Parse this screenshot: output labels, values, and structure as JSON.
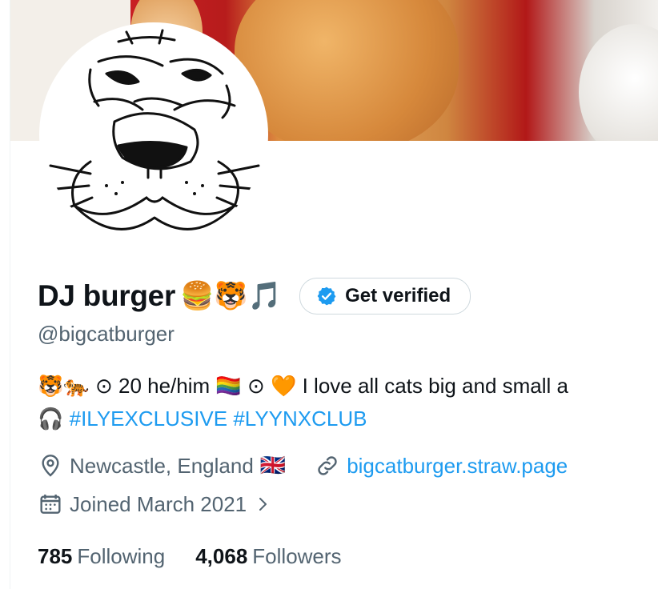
{
  "profile": {
    "display_name": "DJ burger",
    "name_emojis": "🍔🐯🎵",
    "verify_button_label": "Get verified",
    "handle": "@bigcatburger",
    "bio": {
      "line1_emoji_a": "🐯🐅",
      "line1_text_a": " ⊙ 20 he/him ",
      "line1_emoji_b": "🏳️‍🌈",
      "line1_text_b": " ⊙ ",
      "line1_emoji_c": "🧡",
      "line1_text_c": " I love all cats big and small a",
      "line2_emoji": "🎧",
      "line2_hashtags": "#ILYEXCLUSIVE #LYYNXCLUB"
    },
    "location": "Newcastle, England",
    "location_flag": "🇬🇧",
    "website": "bigcatburger.straw.page",
    "joined": "Joined March 2021",
    "following_count": "785",
    "following_label": "Following",
    "followers_count": "4,068",
    "followers_label": "Followers"
  },
  "icons": {
    "verified": "verified-badge-icon",
    "location": "location-pin-icon",
    "link": "link-icon",
    "calendar": "calendar-icon",
    "chevron": "chevron-right-icon"
  },
  "colors": {
    "accent": "#1d9bf0",
    "secondary_text": "#536471",
    "primary_text": "#0f1419",
    "border": "#cfd9de"
  }
}
